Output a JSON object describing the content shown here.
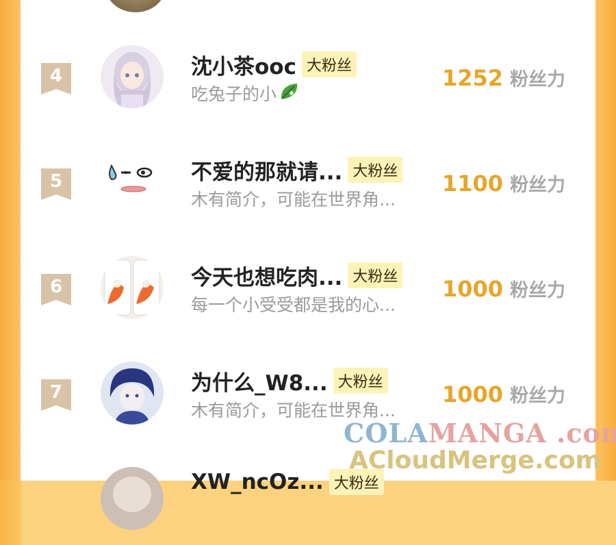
{
  "rows": [
    {
      "rank": "4",
      "name": "沈小茶ooc",
      "badge": "大粉丝",
      "bio": "吃兔子的小",
      "score": "1252",
      "unit": "粉丝力"
    },
    {
      "rank": "5",
      "name": "不爱的那就请...",
      "badge": "大粉丝",
      "bio": "木有简介，可能在世界角...",
      "score": "1100",
      "unit": "粉丝力"
    },
    {
      "rank": "6",
      "name": "今天也想吃肉...",
      "badge": "大粉丝",
      "bio": "每一个小受受都是我的心...",
      "score": "1000",
      "unit": "粉丝力"
    },
    {
      "rank": "7",
      "name": "为什么_W8...",
      "badge": "大粉丝",
      "bio": "木有简介，可能在世界角...",
      "score": "1000",
      "unit": "粉丝力"
    },
    {
      "rank": "",
      "name": "XW_ncOz...",
      "badge": "大粉丝",
      "bio": "",
      "score": "",
      "unit": ""
    }
  ],
  "watermark": {
    "line1_a": "COLA",
    "line1_b": "MANGA",
    "line1_c": " .com",
    "line2": "ACloudMerge.com"
  },
  "colors": {
    "accent": "#e7a52a",
    "badge_bg": "#fdf3b9",
    "rank_marker": "#d9c3a7",
    "side": "#f9b447"
  }
}
